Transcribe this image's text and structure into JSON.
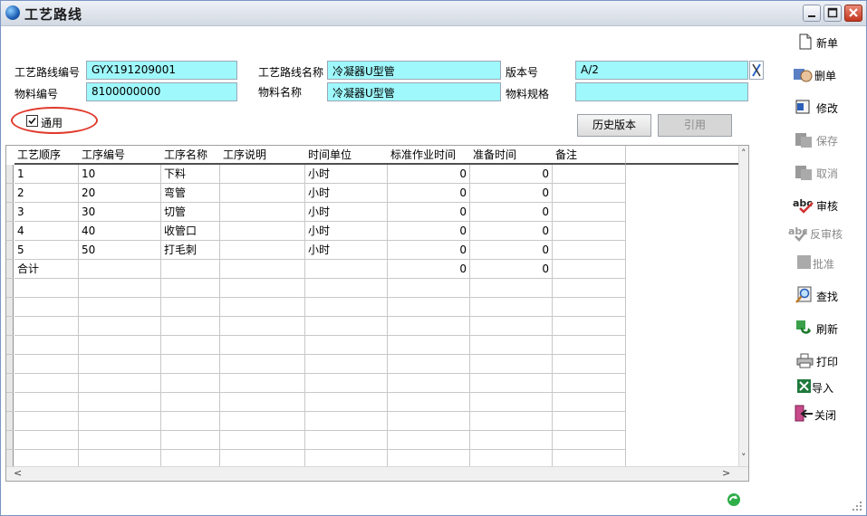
{
  "window": {
    "title": "工艺路线"
  },
  "header": {
    "route_no_label": "工艺路线编号",
    "route_no": "GYX191209001",
    "route_name_label": "工艺路线名称",
    "route_name": "冷凝器U型管",
    "version_label": "版本号",
    "version": "A/2",
    "material_no_label": "物料编号",
    "material_no": "8100000000",
    "material_name_label": "物料名称",
    "material_name": "冷凝器U型管",
    "material_spec_label": "物料规格",
    "material_spec": "",
    "general_label": "通用",
    "general_checked": true
  },
  "buttons": {
    "history": "历史版本",
    "cite": "引用"
  },
  "table": {
    "columns": [
      "工艺顺序",
      "工序编号",
      "工序名称",
      "工序说明",
      "时间单位",
      "标准作业时间",
      "准备时间",
      "备注"
    ],
    "rows": [
      [
        "1",
        "10",
        "下料",
        "",
        "小时",
        "0",
        "0",
        ""
      ],
      [
        "2",
        "20",
        "弯管",
        "",
        "小时",
        "0",
        "0",
        ""
      ],
      [
        "3",
        "30",
        "切管",
        "",
        "小时",
        "0",
        "0",
        ""
      ],
      [
        "4",
        "40",
        "收管口",
        "",
        "小时",
        "0",
        "0",
        ""
      ],
      [
        "5",
        "50",
        "打毛刺",
        "",
        "小时",
        "0",
        "0",
        ""
      ],
      [
        "合计",
        "",
        "",
        "",
        "",
        "0",
        "0",
        ""
      ]
    ]
  },
  "sidebar": {
    "new": "新单",
    "delete": "删单",
    "edit": "修改",
    "save": "保存",
    "cancel": "取消",
    "audit": "审核",
    "unaudit": "反审核",
    "approve": "批准",
    "find": "查找",
    "refresh": "刷新",
    "print": "打印",
    "import": "导入",
    "close": "关闭"
  },
  "colors": {
    "field_bg": "#9ff8fb",
    "highlight_circle": "#e0392c"
  }
}
